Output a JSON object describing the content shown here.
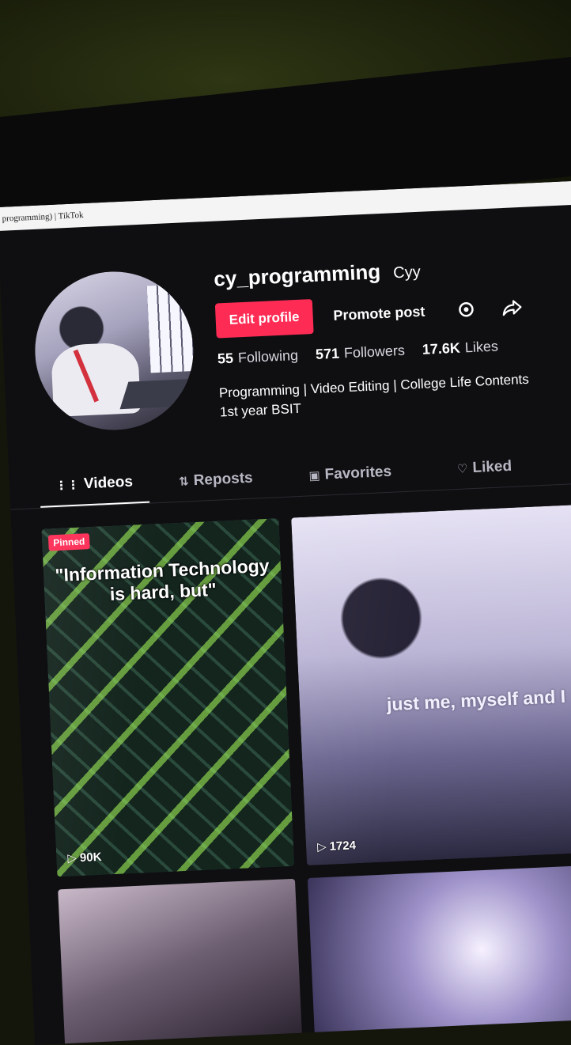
{
  "window": {
    "title": "programming) | TikTok"
  },
  "profile": {
    "username": "cy_programming",
    "nickname": "Cyy",
    "edit_label": "Edit profile",
    "promote_label": "Promote post",
    "stats": {
      "following_count": "55",
      "following_label": "Following",
      "followers_count": "571",
      "followers_label": "Followers",
      "likes_count": "17.6K",
      "likes_label": "Likes"
    },
    "bio_line1": "Programming | Video Editing | College Life Contents",
    "bio_line2": "1st year BSIT"
  },
  "tabs": [
    {
      "label": "Videos",
      "icon": "grid-icon",
      "active": true
    },
    {
      "label": "Reposts",
      "icon": "repost-icon"
    },
    {
      "label": "Favorites",
      "icon": "bookmark-icon"
    },
    {
      "label": "Liked",
      "icon": "heart-icon"
    }
  ],
  "videos": [
    {
      "pinned_label": "Pinned",
      "caption": "\"Information Technology is hard, but\"",
      "views": "90K"
    },
    {
      "caption": "just me, myself and I",
      "views": "1724"
    },
    {
      "caption": "",
      "views": ""
    },
    {
      "caption": "",
      "views": ""
    }
  ],
  "colors": {
    "accent": "#fe2c55",
    "background": "#0f0f12"
  }
}
